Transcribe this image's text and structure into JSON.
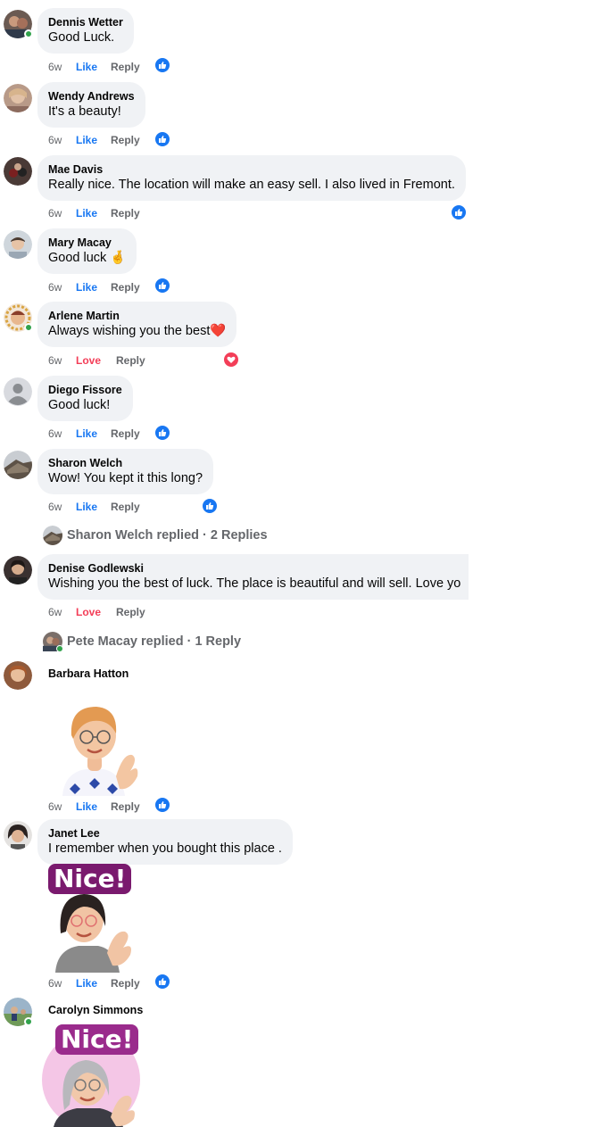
{
  "comments": [
    {
      "name": "Dennis Wetter",
      "text": "Good Luck.",
      "time": "6w",
      "action": "Like",
      "reply": "Reply",
      "reaction": "like"
    },
    {
      "name": "Wendy Andrews",
      "text": "It's a beauty!",
      "time": "6w",
      "action": "Like",
      "reply": "Reply",
      "reaction": "like"
    },
    {
      "name": "Mae Davis",
      "text": "Really nice. The location will make an easy sell. I also lived in Fremont.",
      "time": "6w",
      "action": "Like",
      "reply": "Reply",
      "reaction": "like"
    },
    {
      "name": "Mary Macay",
      "text": "Good luck 🤞",
      "time": "6w",
      "action": "Like",
      "reply": "Reply",
      "reaction": "like"
    },
    {
      "name": "Arlene Martin",
      "text": "Always wishing you the best❤️",
      "time": "6w",
      "action": "Love",
      "reply": "Reply",
      "reaction": "love"
    },
    {
      "name": "Diego Fissore",
      "text": "Good luck!",
      "time": "6w",
      "action": "Like",
      "reply": "Reply",
      "reaction": "like"
    },
    {
      "name": "Sharon Welch",
      "text": "Wow! You kept it this long?",
      "time": "6w",
      "action": "Like",
      "reply": "Reply",
      "reaction": "like"
    },
    {
      "name": "Denise Godlewski",
      "text": "Wishing you the best of luck. The place is beautiful and will sell. Love yo",
      "time": "6w",
      "action": "Love",
      "reply": "Reply",
      "reaction": "none"
    },
    {
      "name": "Barbara Hatton",
      "text": "",
      "time": "6w",
      "action": "Like",
      "reply": "Reply",
      "reaction": "like"
    },
    {
      "name": "Janet Lee",
      "text": "I remember when you bought this place .",
      "time": "6w",
      "action": "Like",
      "reply": "Reply",
      "reaction": "like"
    },
    {
      "name": "Carolyn Simmons",
      "text": "",
      "time": "",
      "action": "",
      "reply": "",
      "reaction": "none"
    }
  ],
  "reply_threads": [
    {
      "label": "Sharon Welch replied · 2 Replies"
    },
    {
      "label": "Pete Macay replied · 1 Reply"
    }
  ],
  "stickers": {
    "janet": "Nice!",
    "carolyn": "Nice!"
  },
  "colors": {
    "like_blue": "#1877f2",
    "love_red": "#f33e58",
    "bubble_bg": "#f0f2f5",
    "muted_text": "#65676b",
    "online_green": "#31a24c"
  }
}
